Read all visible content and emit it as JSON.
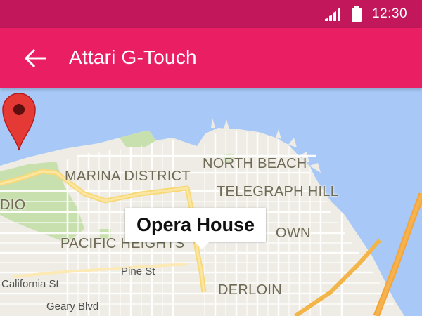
{
  "status_bar": {
    "time": "12:30",
    "icons": [
      "signal-icon",
      "battery-icon"
    ]
  },
  "app_bar": {
    "title": "Attari G-Touch",
    "back_icon": "arrow-back-icon"
  },
  "map": {
    "labels": {
      "marina_district": "MARINA DISTRICT",
      "north_beach": "NORTH BEACH",
      "telegraph_hill": "TELEGRAPH HILL",
      "presidio_fragment": "DIO",
      "pacific_heights": "PACIFIC HEIGHTS",
      "downtown_fragment": "OWN",
      "tenderloin_fragment": "DERLOIN"
    },
    "streets": {
      "california": "California St",
      "pine": "Pine St",
      "geary": "Geary Blvd"
    },
    "marker": {
      "label": "Opera House",
      "icon": "map-pin-icon",
      "color": "#e53935"
    }
  },
  "colors": {
    "status_bar": "#c2185b",
    "app_bar": "#e91e63",
    "water": "#a8c9f7",
    "land": "#eeece4",
    "park": "#c7e0ae"
  }
}
